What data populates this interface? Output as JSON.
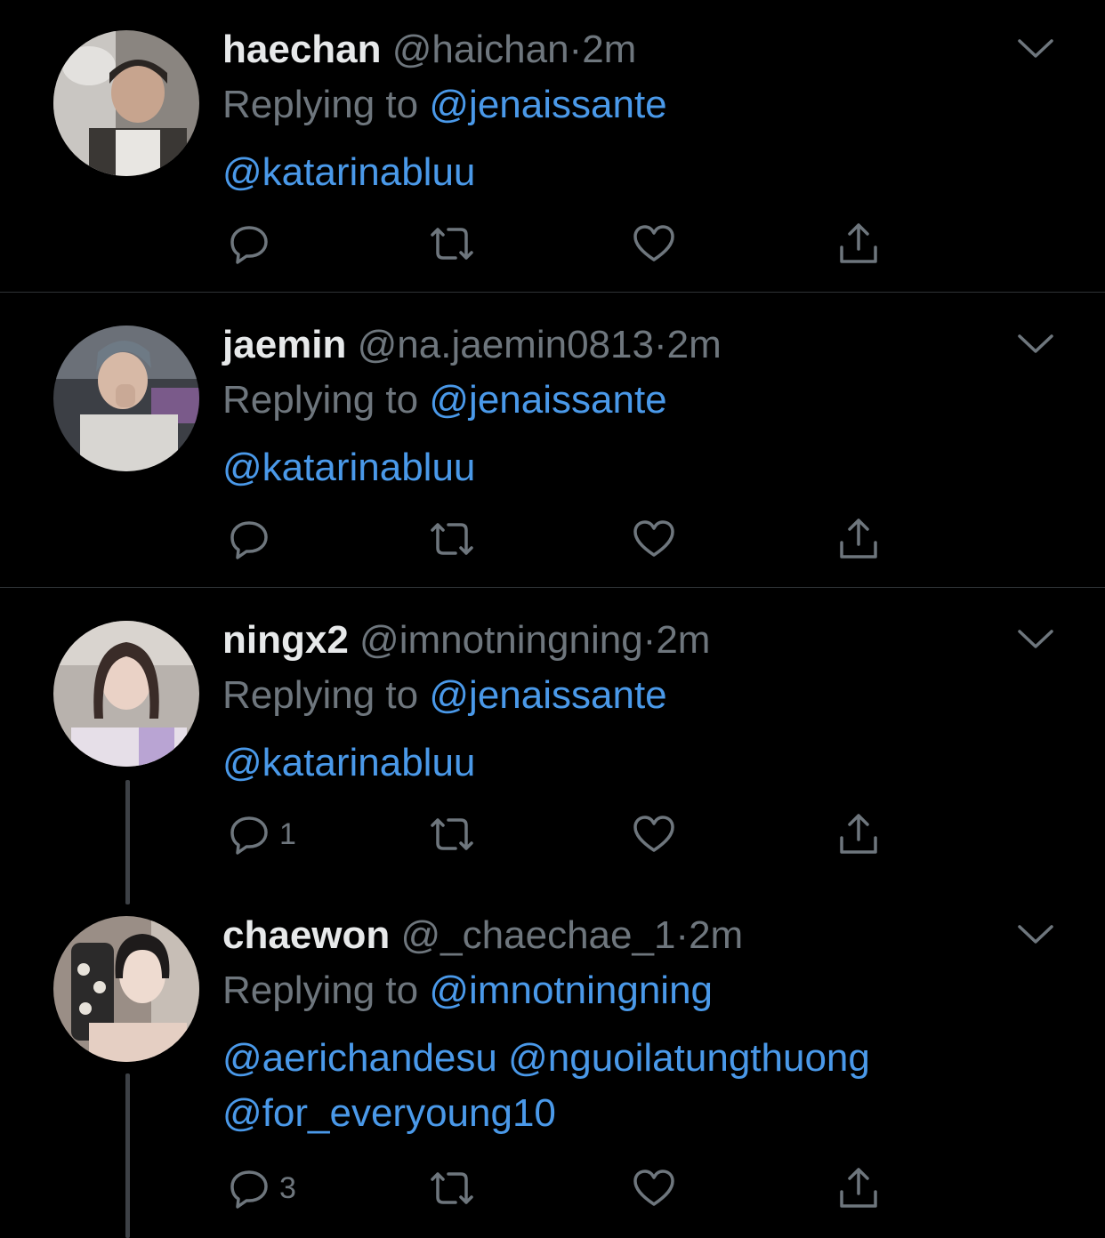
{
  "colors": {
    "background": "#000000",
    "name": "#e7e9ea",
    "secondary": "#6e767d",
    "link": "#4a99e9",
    "divider": "#2f3336"
  },
  "icons": [
    "chevron-down-icon",
    "reply-icon",
    "retweet-icon",
    "like-icon",
    "share-icon"
  ],
  "replying_label": "Replying to",
  "separator": "·",
  "tweets": [
    {
      "name": "haechan",
      "handle": "@haichan",
      "time": "2m",
      "replying_to": "@jenaissante",
      "body_lines": [
        "@katarinabluu"
      ],
      "reply_count": ""
    },
    {
      "name": "jaemin",
      "handle": "@na.jaemin0813",
      "time": "2m",
      "replying_to": "@jenaissante",
      "body_lines": [
        "@katarinabluu"
      ],
      "reply_count": ""
    },
    {
      "name": "ningx2",
      "handle": "@imnotningning",
      "time": "2m",
      "replying_to": "@jenaissante",
      "body_lines": [
        "@katarinabluu"
      ],
      "reply_count": "1"
    },
    {
      "name": "chaewon",
      "handle": "@_chaechae_1",
      "time": "2m",
      "replying_to": "@imnotningning",
      "body_lines": [
        "@aerichandesu @nguoilatungthuong",
        "@for_everyoung10"
      ],
      "reply_count": "3"
    }
  ]
}
